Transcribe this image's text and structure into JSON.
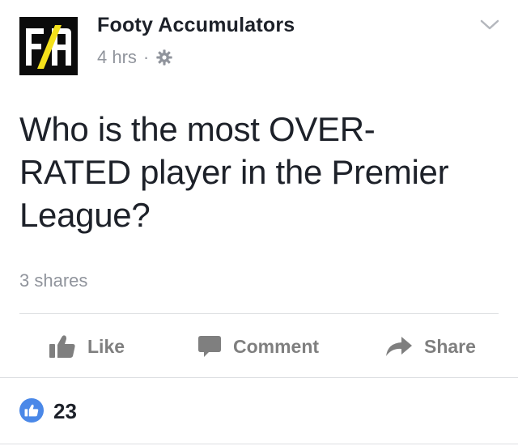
{
  "post": {
    "page_name": "Footy Accumulators",
    "avatar_text": "FA",
    "timestamp": "4 hrs",
    "separator": "·",
    "text_lines": [
      "Who is the most OVER-",
      "RATED player in the Premier",
      "League?"
    ],
    "shares": "3 shares"
  },
  "actions": {
    "like": "Like",
    "comment": "Comment",
    "share": "Share"
  },
  "reactions": {
    "count": "23"
  },
  "colors": {
    "text": "#1d2129",
    "meta": "#90949c",
    "action": "#7f7f7f",
    "divider": "#dddfe2",
    "like_badge": "#4a88e8",
    "avatar_bg": "#0b0b0b",
    "avatar_stripe": "#f4e11b"
  },
  "icons": [
    "privacy-gear-icon",
    "chevron-down-icon",
    "like-thumb-icon",
    "comment-bubble-icon",
    "share-arrow-icon",
    "like-reaction-icon"
  ]
}
